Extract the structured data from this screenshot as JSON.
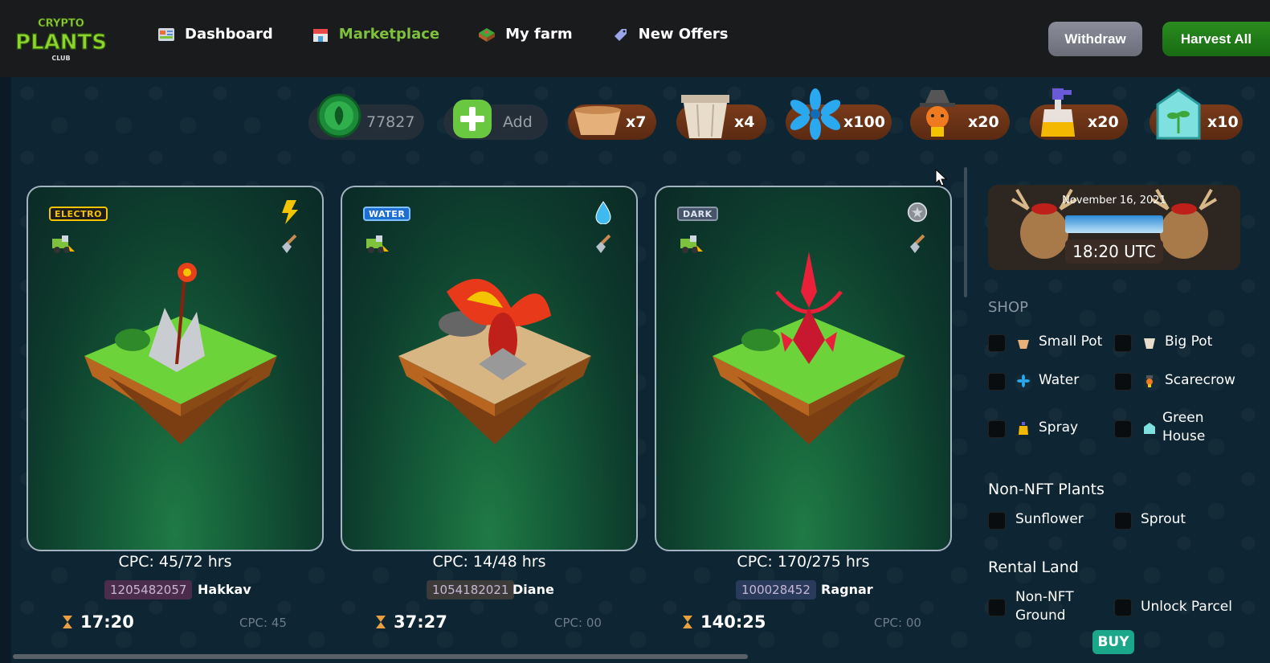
{
  "logo": {
    "line1": "CRYPTO",
    "line2": "PLANTS",
    "line3": "CLUB"
  },
  "nav": [
    {
      "label": "Dashboard",
      "icon": "dashboard-icon",
      "active": false
    },
    {
      "label": "Marketplace",
      "icon": "marketplace-icon",
      "active": true
    },
    {
      "label": "My farm",
      "icon": "farm-icon",
      "active": false
    },
    {
      "label": "New Offers",
      "icon": "offers-icon",
      "active": false
    }
  ],
  "buttons": {
    "withdraw": "Withdraw",
    "harvest_all": "Harvest All"
  },
  "inventory": {
    "coins": "77827",
    "add_label": "Add",
    "small_pot": "x7",
    "big_pot": "x4",
    "water": "x100",
    "scarecrow": "x20",
    "spray": "x20",
    "greenhouse": "x10"
  },
  "cards": [
    {
      "element": "ELECTRO",
      "cpc_title": "CPC: 45/72 hrs",
      "id": "1205482057",
      "owner": "Hakkav",
      "timer": "17:20",
      "cpc": "CPC: 45"
    },
    {
      "element": "WATER",
      "cpc_title": "CPC: 14/48 hrs",
      "id": "1054182021",
      "owner": "Diane",
      "timer": "37:27",
      "cpc": "CPC: 00"
    },
    {
      "element": "DARK",
      "cpc_title": "CPC: 170/275 hrs",
      "id": "100028452",
      "owner": "Ragnar",
      "timer": "140:25",
      "cpc": "CPC: 00"
    }
  ],
  "date_panel": {
    "date": "November 16, 2021",
    "time": "18:20 UTC"
  },
  "sidebar": {
    "shop_title": "SHOP",
    "shop_items": [
      "Small Pot",
      "Big Pot",
      "Water",
      "Scarecrow",
      "Spray",
      "Green",
      "House"
    ],
    "non_nft_title": "Non-NFT Plants",
    "non_nft_items": [
      "Sunflower",
      "Sprout"
    ],
    "rental_title": "Rental Land",
    "rental_items": [
      "Non-NFT",
      "Ground",
      "Unlock Parcel"
    ],
    "buy_label": "BUY"
  },
  "colors": {
    "active_nav": "#7ec13d",
    "harvest": "#1f7d17",
    "withdraw": "#7b7e89",
    "buy": "#1aa78a"
  }
}
